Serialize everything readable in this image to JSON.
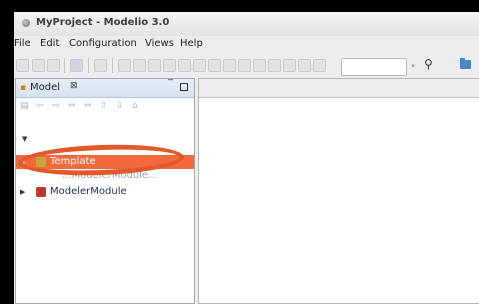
{
  "window": {
    "title": "MyProject - Modelio 3.0"
  },
  "menu": [
    "File",
    "Edit",
    "Configuration",
    "Views",
    "Help"
  ],
  "toolbar": {
    "combo_value": ""
  },
  "model_panel": {
    "title": "Model",
    "close_glyph": "⊠",
    "minimize_glyph": "‾",
    "tree": [
      {
        "label": "Template",
        "selected": true,
        "icon_color": "#c6a53a"
      },
      {
        "label": "ModelerModule",
        "selected": false,
        "icon_color": "#c0392b"
      }
    ],
    "partially_hidden_label": "...ModelerModule..."
  },
  "annotation": {
    "ring_color": "#e25a2a"
  },
  "colors": {
    "selection": "#f06a3e",
    "panel_header": "#d6e2f1"
  }
}
